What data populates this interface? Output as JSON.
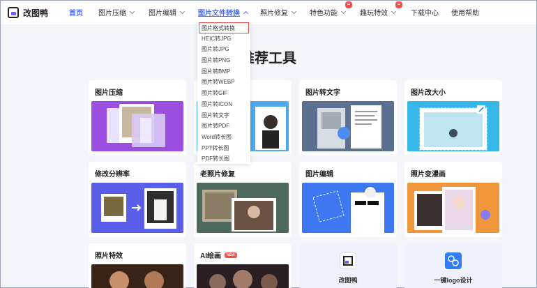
{
  "brand": {
    "name": "改图鸭"
  },
  "nav": {
    "items": [
      {
        "label": "首页"
      },
      {
        "label": "图片压缩"
      },
      {
        "label": "图片编辑"
      },
      {
        "label": "图片文件转换"
      },
      {
        "label": "照片修复"
      },
      {
        "label": "特色功能"
      },
      {
        "label": "趣玩特效"
      },
      {
        "label": "下载中心"
      },
      {
        "label": "使用帮助"
      }
    ]
  },
  "dropdown": {
    "items": [
      "图片格式转换",
      "HEIC转JPG",
      "图片转JPG",
      "图片转PNG",
      "图片转BMP",
      "图片转WEBP",
      "图片转GIF",
      "图片转ICON",
      "图片转文字",
      "图片转PDF",
      "Word转长图",
      "PPT转长图",
      "PDF转长图"
    ]
  },
  "main": {
    "title": "推荐工具",
    "cards": [
      {
        "label": "图片压缩"
      },
      {
        "label": ""
      },
      {
        "label": "图片转文字"
      },
      {
        "label": "图片改大小"
      },
      {
        "label": "修改分辨率"
      },
      {
        "label": "老照片修复"
      },
      {
        "label": "图片编辑"
      },
      {
        "label": "照片变漫画"
      },
      {
        "label": "照片特效"
      },
      {
        "label": "AI绘画",
        "badge": "NEW"
      }
    ],
    "promos": [
      {
        "label": "改图鸭"
      },
      {
        "label": "一键logo设计"
      }
    ]
  },
  "colors": {
    "accent": "#4e6ef2",
    "badge": "#f0514e"
  }
}
